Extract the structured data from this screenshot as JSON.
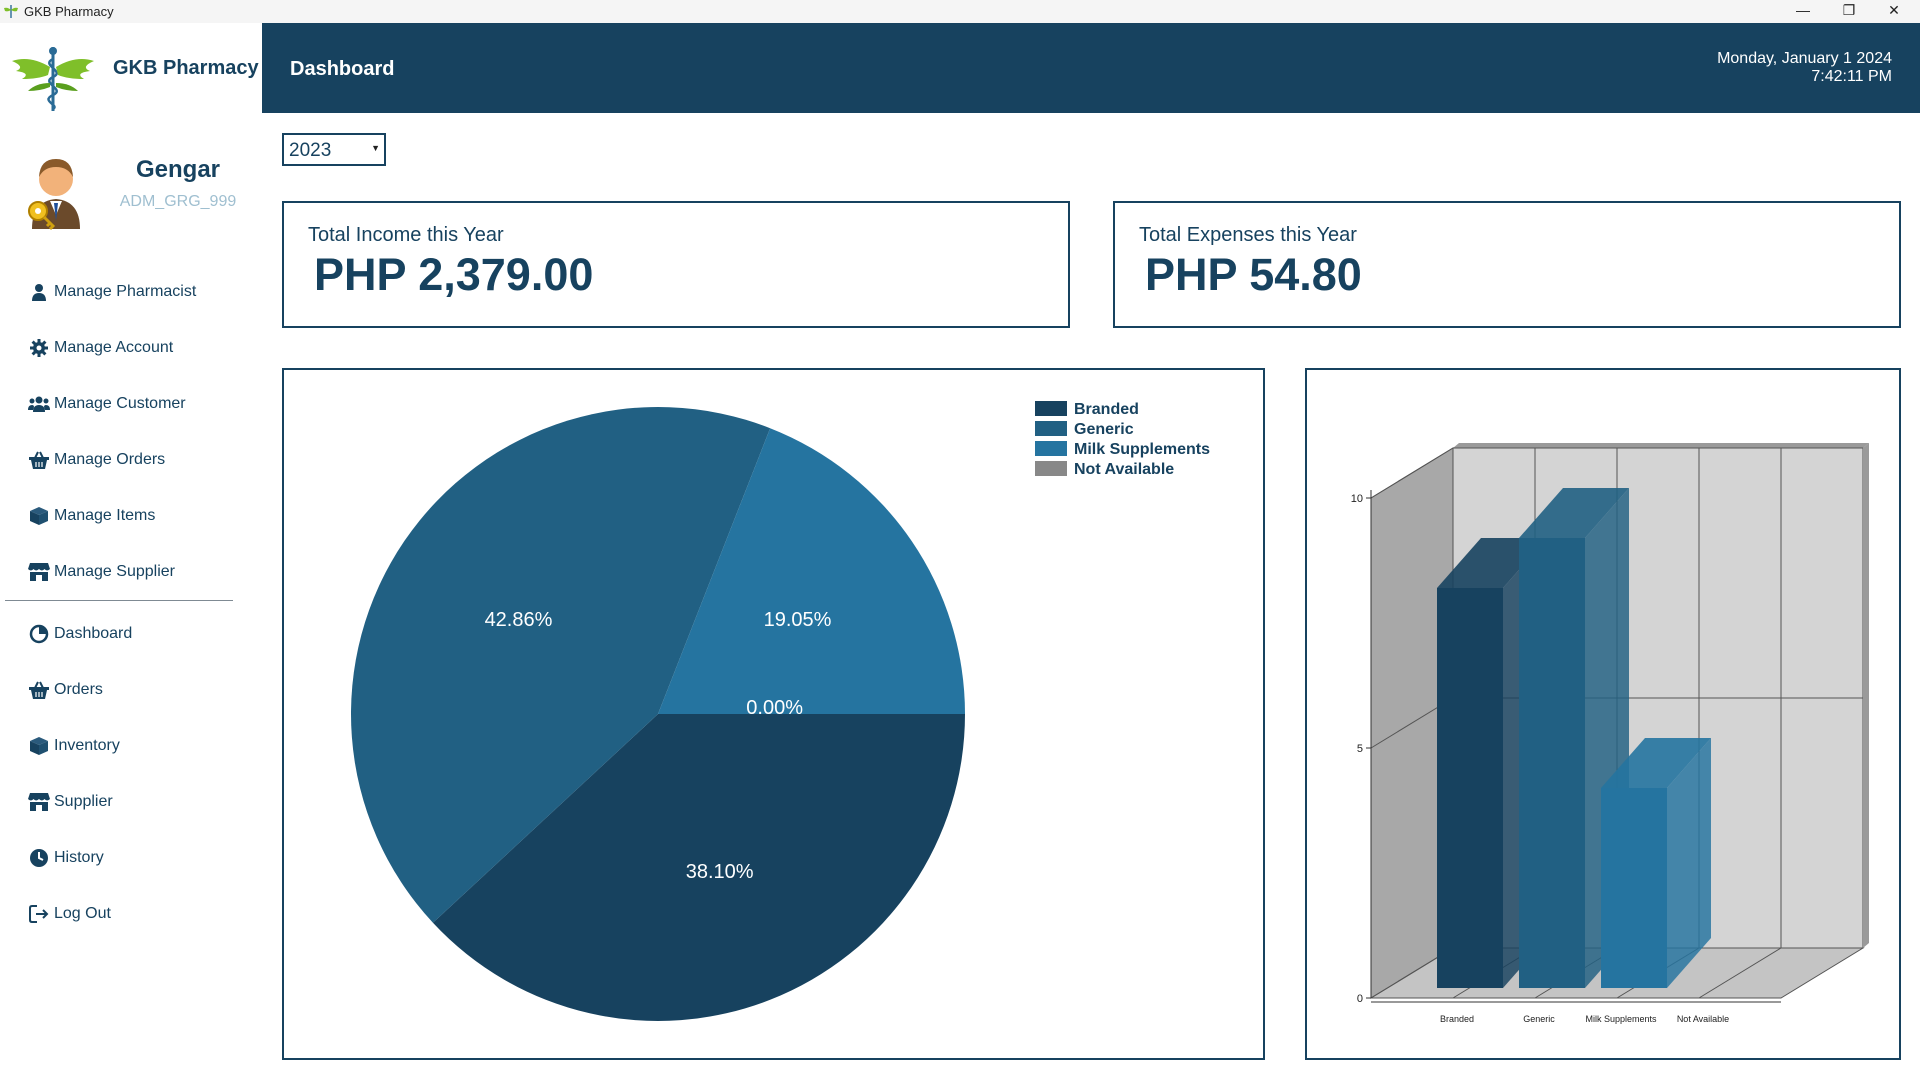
{
  "window": {
    "title": "GKB Pharmacy",
    "minimize_glyph": "—",
    "restore_glyph": "❐",
    "close_glyph": "✕"
  },
  "brand": {
    "name": "GKB Pharmacy",
    "logo_icon": "caduceus-wings-icon"
  },
  "user": {
    "name": "Gengar",
    "id": "ADM_GRG_999",
    "avatar_icon": "admin-user-key-icon"
  },
  "nav": {
    "admin_items": [
      {
        "label": "Manage Pharmacist",
        "icon": "user-icon"
      },
      {
        "label": "Manage Account",
        "icon": "gear-icon"
      },
      {
        "label": "Manage Customer",
        "icon": "users-icon"
      },
      {
        "label": "Manage Orders",
        "icon": "basket-icon"
      },
      {
        "label": "Manage Items",
        "icon": "box-icon"
      },
      {
        "label": "Manage Supplier",
        "icon": "store-icon"
      }
    ],
    "main_items": [
      {
        "label": "Dashboard",
        "icon": "pie-chart-icon"
      },
      {
        "label": "Orders",
        "icon": "basket-icon"
      },
      {
        "label": "Inventory",
        "icon": "box-icon"
      },
      {
        "label": "Supplier",
        "icon": "store-icon"
      },
      {
        "label": "History",
        "icon": "clock-icon"
      },
      {
        "label": "Log Out",
        "icon": "logout-icon"
      }
    ]
  },
  "header": {
    "title": "Dashboard",
    "date": "Monday, January 1 2024",
    "time": "7:42:11 PM"
  },
  "filter": {
    "year": "2023"
  },
  "stats": {
    "income": {
      "label": "Total Income this Year",
      "value": "PHP 2,379.00"
    },
    "expenses": {
      "label": "Total Expenses this Year",
      "value": "PHP 54.80"
    }
  },
  "colors": {
    "primary": "#17425f",
    "branded": "#17425f",
    "generic": "#216083",
    "milk": "#2574a0",
    "not_available": "#888888"
  },
  "chart_data": [
    {
      "type": "pie",
      "categories": [
        "Branded",
        "Generic",
        "Milk Supplements",
        "Not Available"
      ],
      "values": [
        38.1,
        42.86,
        19.05,
        0.0
      ],
      "labels": [
        "38.10%",
        "42.86%",
        "19.05%",
        "0.00%"
      ],
      "colors": [
        "#17425f",
        "#216083",
        "#2574a0",
        "#888888"
      ],
      "legend": "top-right"
    },
    {
      "type": "bar",
      "style": "3d",
      "categories": [
        "Branded",
        "Generic",
        "Milk Supplements",
        "Not Available"
      ],
      "values": [
        8,
        9,
        4,
        0
      ],
      "colors": [
        "#17425f",
        "#216083",
        "#2574a0",
        "#888888"
      ],
      "ylim": [
        0,
        10
      ],
      "yticks": [
        0,
        5,
        10
      ],
      "grid": true
    }
  ]
}
